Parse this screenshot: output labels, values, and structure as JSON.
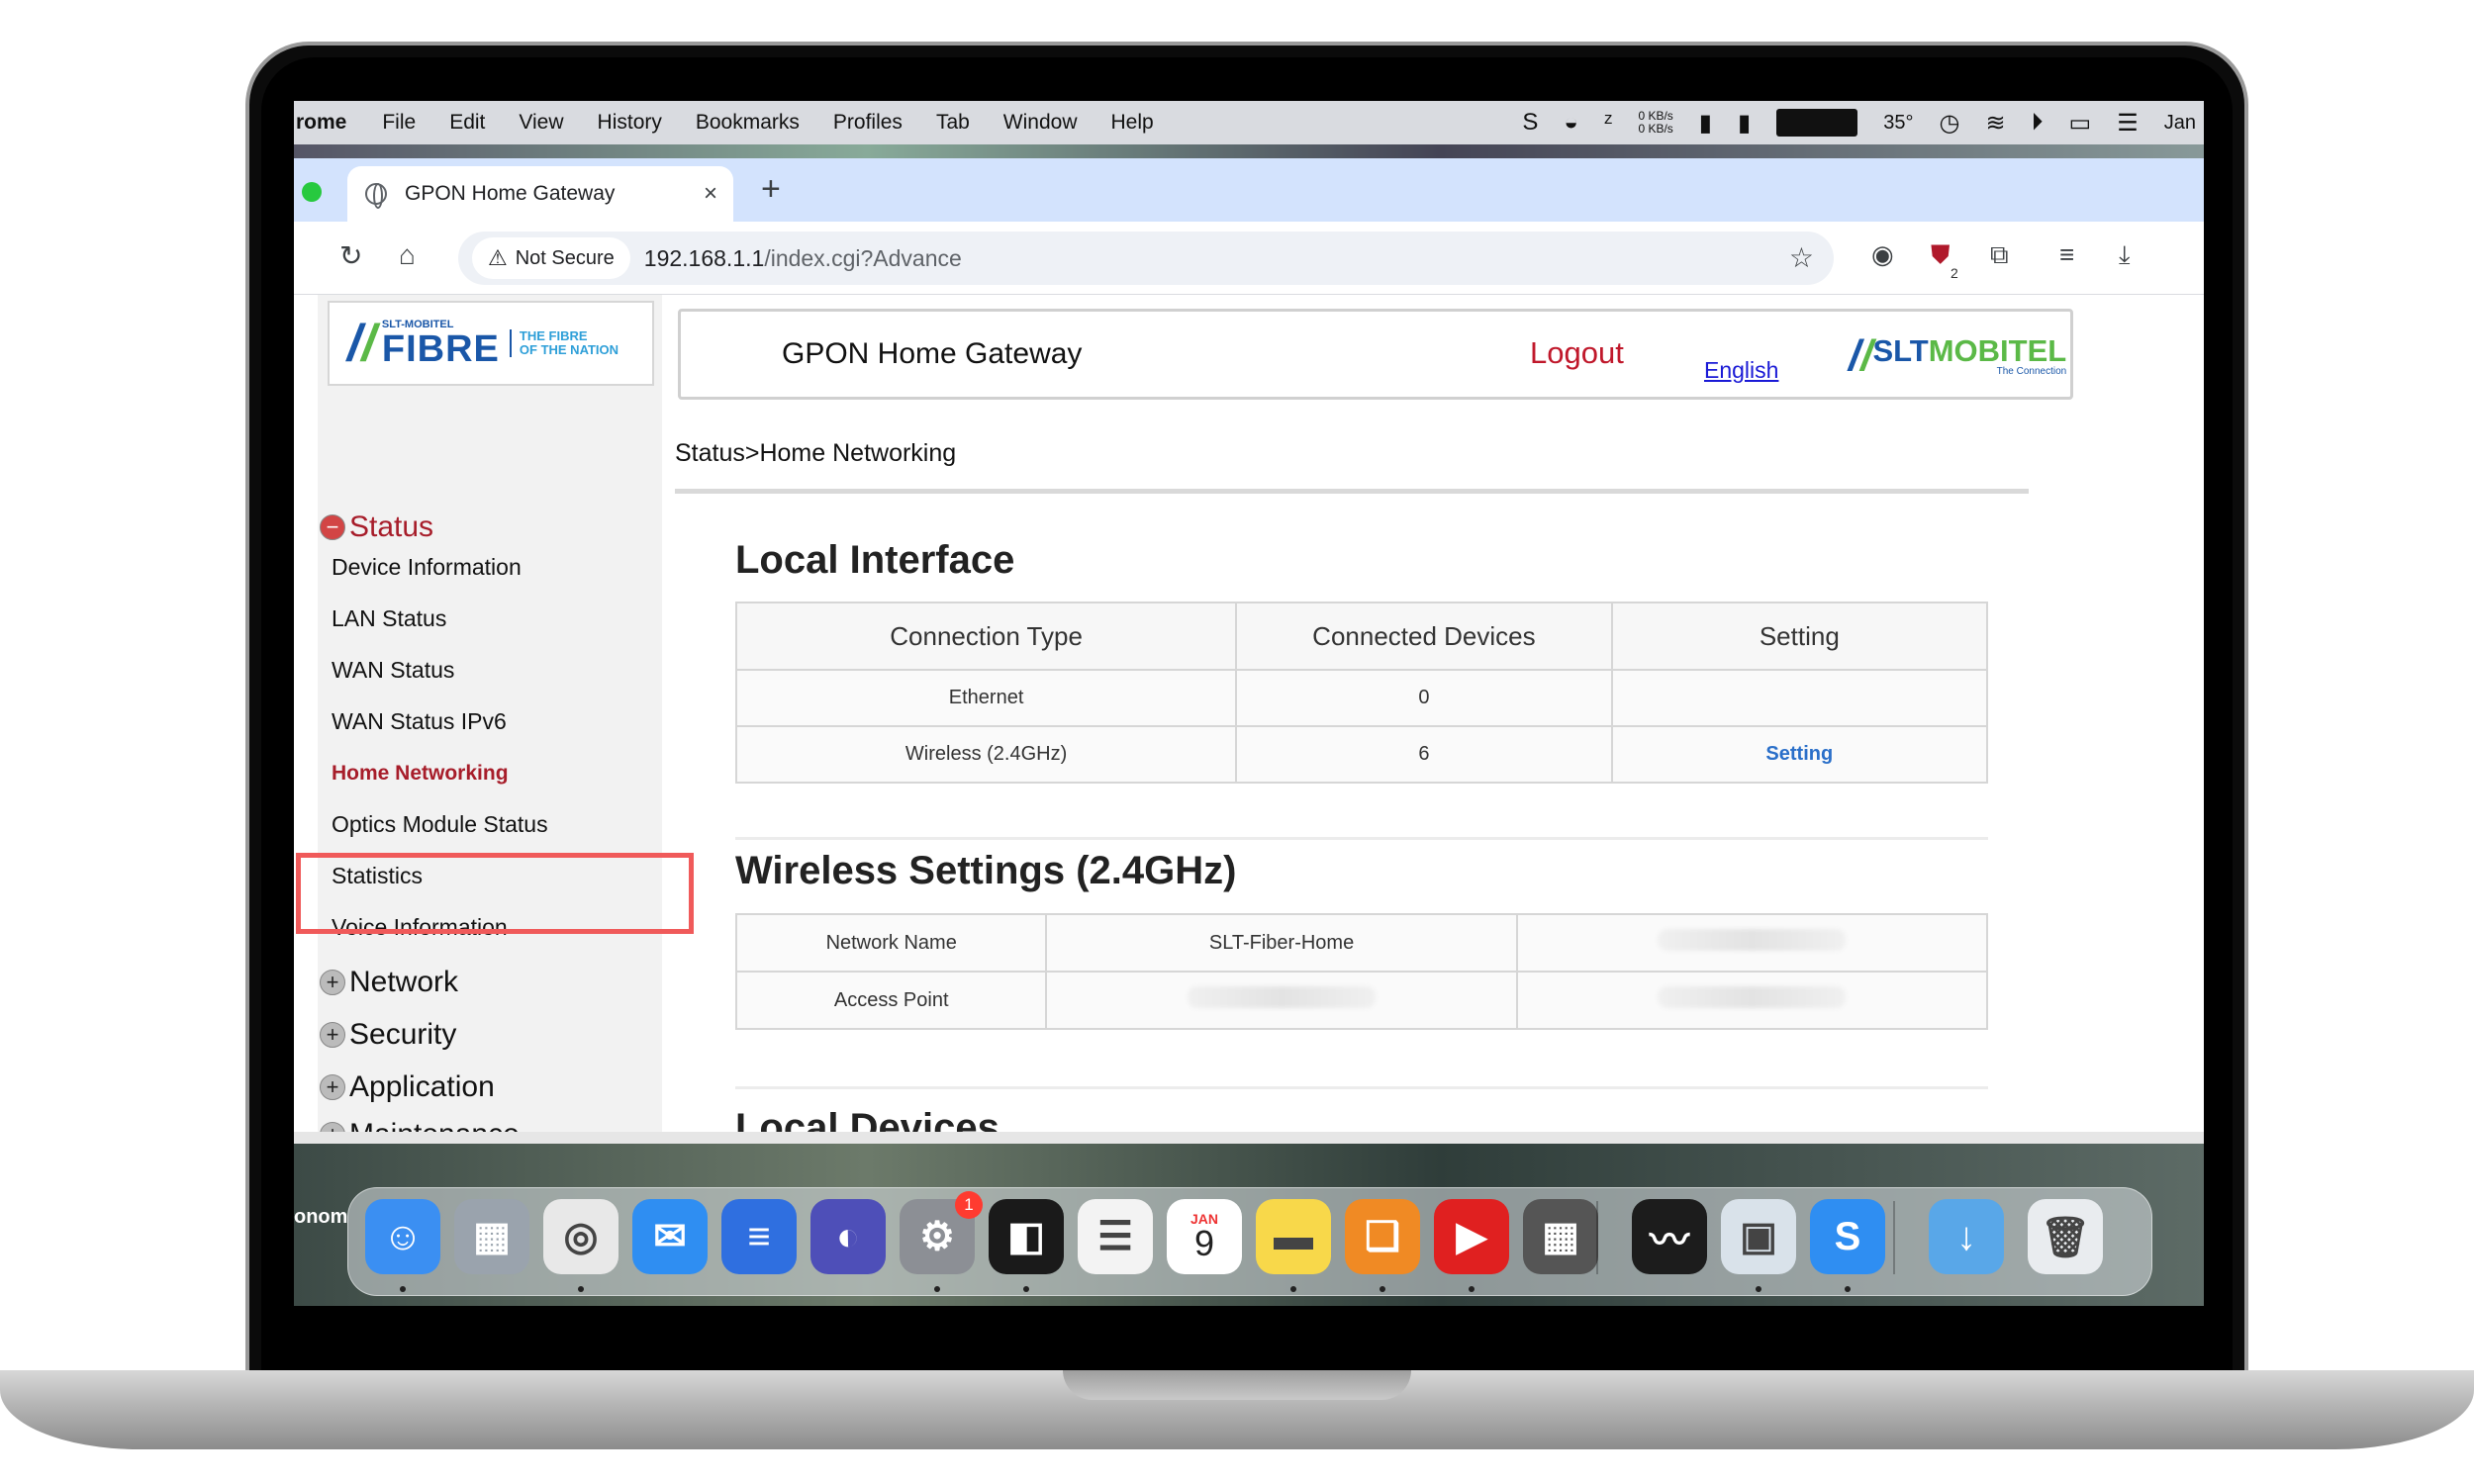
{
  "menubar": {
    "app_name": "rome",
    "items": [
      "File",
      "Edit",
      "View",
      "History",
      "Bookmarks",
      "Profiles",
      "Tab",
      "Window",
      "Help"
    ],
    "net_up": "0 KB/s",
    "net_down": "0 KB/s",
    "temperature": "35°",
    "clock": "Jan"
  },
  "browser": {
    "tab_title": "GPON Home Gateway",
    "security_label": "Not Secure",
    "url_host": "192.168.1.1",
    "url_path": "/index.cgi?Advance",
    "extension_badge": "2"
  },
  "router": {
    "fibre_logo": {
      "small": "SLT-MOBITEL",
      "big": "FIBRE",
      "tagline_1": "THE FIBRE",
      "tagline_2": "OF THE NATION"
    },
    "gateway_title": "GPON Home Gateway",
    "logout_label": "Logout",
    "language_label": "English",
    "brand_logo": {
      "name_a": "SLT",
      "name_b": "MOBITEL",
      "sub": "The Connection"
    },
    "breadcrumb": "Status>Home Networking",
    "sidebar": {
      "status_section": "Status",
      "status_items": [
        "Device Information",
        "LAN Status",
        "WAN Status",
        "WAN Status IPv6",
        "Home Networking",
        "Optics Module Status",
        "Statistics",
        "Voice Information"
      ],
      "active_item": "Home Networking",
      "other_sections": [
        "Network",
        "Security",
        "Application",
        "Maintenance"
      ]
    },
    "local_interface": {
      "title": "Local Interface",
      "headers": [
        "Connection Type",
        "Connected Devices",
        "Setting"
      ],
      "rows": [
        {
          "type": "Ethernet",
          "devices": "0",
          "setting": ""
        },
        {
          "type": "Wireless (2.4GHz)",
          "devices": "6",
          "setting": "Setting"
        }
      ]
    },
    "wireless_settings": {
      "title": "Wireless Settings (2.4GHz)",
      "rows": [
        {
          "label": "Network Name",
          "value": "SLT-Fiber-Home"
        },
        {
          "label": "Access Point",
          "value": ""
        }
      ]
    },
    "local_devices_title": "Local Devices"
  },
  "desktop": {
    "edge_label": "onom"
  },
  "dock": {
    "apps": [
      {
        "icon": "finder-icon",
        "color": "#3b8ff2"
      },
      {
        "icon": "launchpad-icon",
        "color": "#9aa3ad"
      },
      {
        "icon": "chrome-icon",
        "color": "#e8e8e8"
      },
      {
        "icon": "mail-icon",
        "color": "#2f8ef2"
      },
      {
        "icon": "docs-icon",
        "color": "#2f6fe0"
      },
      {
        "icon": "arc-icon",
        "color": "#4e4fb8"
      },
      {
        "icon": "settings-icon",
        "color": "#8c8f95"
      },
      {
        "icon": "pages-icon",
        "color": "#1a1a1a"
      },
      {
        "icon": "reminders-icon",
        "color": "#f3f3f3"
      },
      {
        "icon": "calendar-icon",
        "color": "#ffffff"
      },
      {
        "icon": "notes-icon",
        "color": "#f8d84a"
      },
      {
        "icon": "books-icon",
        "color": "#f08a24"
      },
      {
        "icon": "youtube-music-icon",
        "color": "#e02020"
      },
      {
        "icon": "calculator-icon",
        "color": "#555555"
      },
      {
        "icon": "voice-memos-icon",
        "color": "#1c1c1c"
      },
      {
        "icon": "preview-icon",
        "color": "#d9e2ea"
      },
      {
        "icon": "setapp-icon",
        "color": "#2f8ef2"
      },
      {
        "icon": "downloads-folder-icon",
        "color": "#59a7e8"
      },
      {
        "icon": "trash-icon",
        "color": "#e9ecef"
      }
    ],
    "settings_badge": "1",
    "calendar_month": "JAN",
    "calendar_day": "9"
  }
}
